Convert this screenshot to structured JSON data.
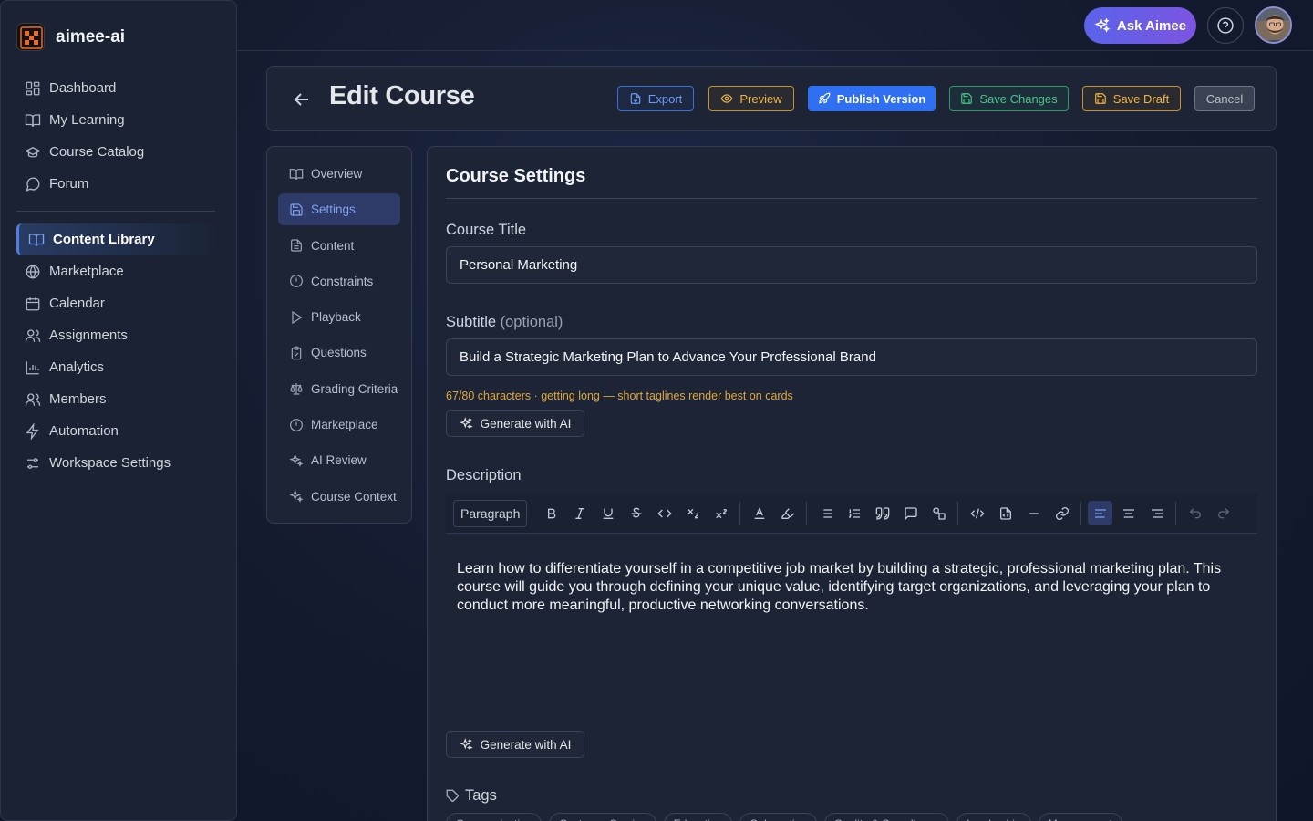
{
  "brand": {
    "name": "aimee-ai"
  },
  "nav": {
    "primary": [
      {
        "label": "Dashboard",
        "icon": "dashboard-icon"
      },
      {
        "label": "My Learning",
        "icon": "book-open-icon"
      },
      {
        "label": "Course Catalog",
        "icon": "graduation-cap-icon"
      },
      {
        "label": "Forum",
        "icon": "message-circle-icon"
      }
    ],
    "secondary": [
      {
        "label": "Content Library",
        "icon": "book-open-icon",
        "active": true
      },
      {
        "label": "Marketplace",
        "icon": "globe-icon"
      },
      {
        "label": "Calendar",
        "icon": "calendar-icon"
      },
      {
        "label": "Assignments",
        "icon": "users-icon"
      },
      {
        "label": "Analytics",
        "icon": "bar-chart-icon"
      },
      {
        "label": "Members",
        "icon": "users-icon"
      },
      {
        "label": "Automation",
        "icon": "lightning-icon"
      },
      {
        "label": "Workspace Settings",
        "icon": "sliders-icon"
      }
    ]
  },
  "topbar": {
    "ask_label": "Ask Aimee"
  },
  "header": {
    "title": "Edit Course",
    "export_label": "Export",
    "preview_label": "Preview",
    "publish_label": "Publish Version",
    "save_label": "Save Changes",
    "draft_label": "Save Draft",
    "cancel_label": "Cancel"
  },
  "tabs": [
    {
      "label": "Overview",
      "icon": "book-open-icon"
    },
    {
      "label": "Settings",
      "icon": "save-icon",
      "active": true
    },
    {
      "label": "Content",
      "icon": "file-text-icon"
    },
    {
      "label": "Constraints",
      "icon": "alert-circle-icon"
    },
    {
      "label": "Playback",
      "icon": "play-icon"
    },
    {
      "label": "Questions",
      "icon": "clipboard-check-icon"
    },
    {
      "label": "Grading Criteria",
      "icon": "scale-icon"
    },
    {
      "label": "Marketplace",
      "icon": "alert-circle-icon"
    },
    {
      "label": "AI Review",
      "icon": "sparkles-icon"
    },
    {
      "label": "Course Context",
      "icon": "sparkles-icon"
    }
  ],
  "settings": {
    "section_title": "Course Settings",
    "title_label": "Course Title",
    "title_value": "Personal Marketing",
    "subtitle_label": "Subtitle",
    "subtitle_optional": "(optional)",
    "subtitle_value": "Build a Strategic Marketing Plan to Advance Your Professional Brand",
    "subtitle_hint": "67/80 characters · getting long — short taglines render best on cards",
    "generate_label": "Generate with AI",
    "description_label": "Description",
    "paragraph_select": "Paragraph",
    "description_text": "Learn how to differentiate yourself in a competitive job market by building a strategic, professional marketing plan. This course will guide you through defining your unique value, identifying target organizations, and leveraging your plan to conduct more meaningful, productive networking conversations.",
    "tags_label": "Tags",
    "tags": [
      "Communication",
      "Customer Service",
      "Education",
      "Onboarding",
      "Quality & Compliance",
      "Leadership",
      "Management"
    ]
  },
  "colors": {
    "accent": "#2f6ff2",
    "ask_gradient_start": "#5b62ea",
    "ask_gradient_end": "#7c55e0",
    "warning": "#e0a63a",
    "success": "#4cc28b"
  }
}
